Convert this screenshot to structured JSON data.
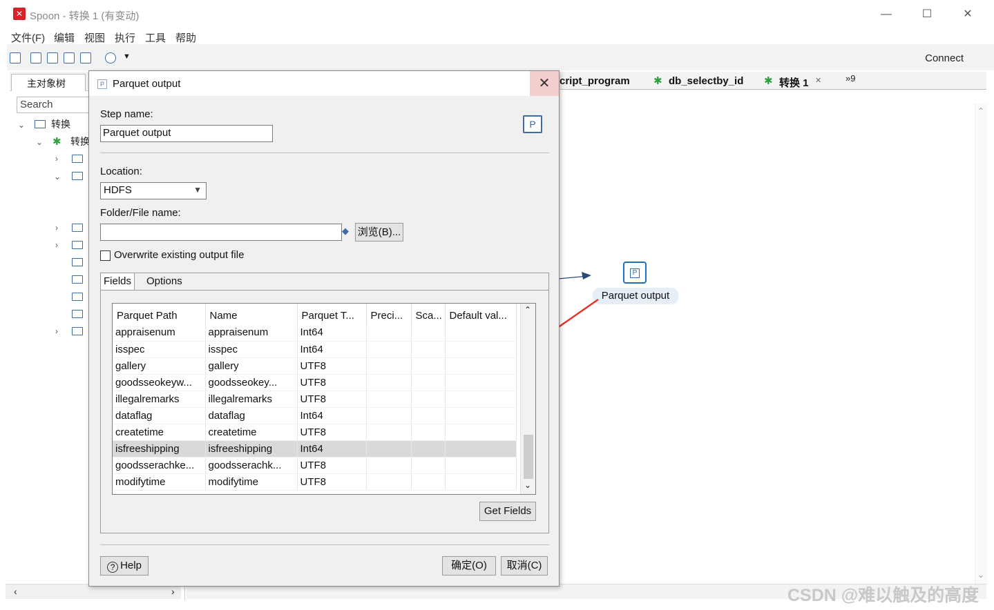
{
  "window": {
    "title": "Spoon - 转换 1 (有变动)",
    "menu": [
      "文件(F)",
      "编辑",
      "视图",
      "执行",
      "工具",
      "帮助"
    ],
    "connect_label": "Connect"
  },
  "left_panel": {
    "tab_label": "主对象树",
    "search_placeholder": "Search",
    "tree_root": "转换",
    "tree_child": "转换"
  },
  "canvas": {
    "tabs": [
      "cript_program",
      "db_selectby_id",
      "转换 1"
    ],
    "tab_overflow": "»9",
    "step_label": "Parquet output",
    "step_icon_letter": "P",
    "watermark": "CSDN @难以触及的高度"
  },
  "dialog": {
    "title": "Parquet output",
    "step_name_label": "Step name:",
    "step_name_value": "Parquet output",
    "location_label": "Location:",
    "location_value": "HDFS",
    "folder_label": "Folder/File name:",
    "folder_value": "",
    "browse_label": "浏览(B)...",
    "overwrite_label": "Overwrite existing output file",
    "overwrite_checked": false,
    "tabs": [
      "Fields",
      "Options"
    ],
    "columns": [
      "Parquet Path",
      "Name",
      "Parquet T...",
      "Preci...",
      "Sca...",
      "Default val..."
    ],
    "rows": [
      [
        "appraisenum",
        "appraisenum",
        "Int64",
        "",
        "",
        ""
      ],
      [
        "isspec",
        "isspec",
        "Int64",
        "",
        "",
        ""
      ],
      [
        "gallery",
        "gallery",
        "UTF8",
        "",
        "",
        ""
      ],
      [
        "goodsseokeyw...",
        "goodsseokey...",
        "UTF8",
        "",
        "",
        ""
      ],
      [
        "illegalremarks",
        "illegalremarks",
        "UTF8",
        "",
        "",
        ""
      ],
      [
        "dataflag",
        "dataflag",
        "Int64",
        "",
        "",
        ""
      ],
      [
        "createtime",
        "createtime",
        "UTF8",
        "",
        "",
        ""
      ],
      [
        "isfreeshipping",
        "isfreeshipping",
        "Int64",
        "",
        "",
        ""
      ],
      [
        "goodsserachke...",
        "goodsserachk...",
        "UTF8",
        "",
        "",
        ""
      ],
      [
        "modifytime",
        "modifytime",
        "UTF8",
        "",
        "",
        ""
      ]
    ],
    "selected_row_index": 7,
    "get_fields_label": "Get Fields",
    "help_label": "Help",
    "ok_label": "确定(O)",
    "cancel_label": "取消(C)"
  }
}
